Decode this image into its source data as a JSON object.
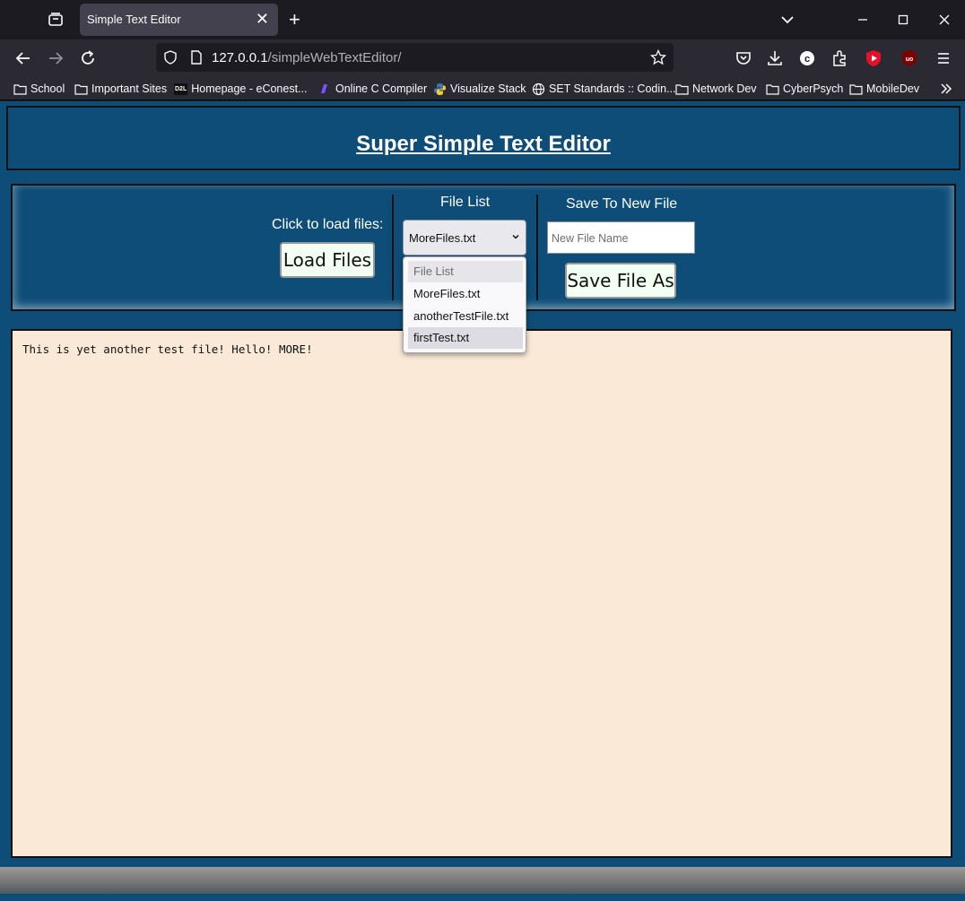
{
  "browser": {
    "tab_title": "Simple Text Editor",
    "url_host": "127.0.0.1",
    "url_path": "/simpleWebTextEditor/",
    "bookmarks": [
      "School",
      "Important Sites",
      "Homepage - eConest...",
      "Online C Compiler",
      "Visualize Stack",
      "SET Standards :: Codin...",
      "Network Dev",
      "CyberPsych",
      "MobileDev"
    ],
    "bookmark_badge": "D2L"
  },
  "page": {
    "title": "Super Simple Text Editor",
    "load_label": "Click to load files:",
    "load_button": "Load Files",
    "file_list_label": "File List",
    "selected_file": "MoreFiles.txt",
    "options": [
      "File List",
      "MoreFiles.txt",
      "anotherTestFile.txt",
      "firstTest.txt"
    ],
    "save_label": "Save To New File",
    "new_file_placeholder": "New File Name",
    "save_button": "Save File As",
    "editor_text": "This is yet another test file! Hello! MORE!"
  },
  "colors": {
    "page_bg": "#0d4d78",
    "editor_bg": "#fae9d6",
    "button_bg": "#f3fff3"
  }
}
